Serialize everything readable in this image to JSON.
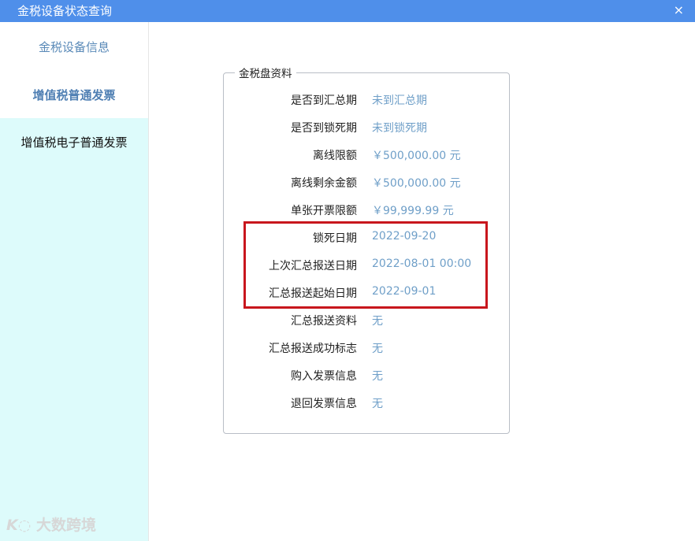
{
  "window": {
    "title": "金税设备状态查询",
    "close_label": "×"
  },
  "sidebar": {
    "items": [
      {
        "label": "金税设备信息"
      },
      {
        "label": "增值税普通发票"
      },
      {
        "label": "增值税电子普通发票"
      }
    ]
  },
  "panel": {
    "legend": "金税盘资料",
    "rows": [
      {
        "label": "是否到汇总期",
        "value": "未到汇总期"
      },
      {
        "label": "是否到锁死期",
        "value": "未到锁死期"
      },
      {
        "label": "离线限额",
        "value": "￥500,000.00 元"
      },
      {
        "label": "离线剩余金额",
        "value": "￥500,000.00 元"
      },
      {
        "label": "单张开票限额",
        "value": "￥99,999.99 元"
      },
      {
        "label": "锁死日期",
        "value": "2022-09-20"
      },
      {
        "label": "上次汇总报送日期",
        "value": "2022-08-01 00:00"
      },
      {
        "label": "汇总报送起始日期",
        "value": "2022-09-01"
      },
      {
        "label": "汇总报送资料",
        "value": "无"
      },
      {
        "label": "汇总报送成功标志",
        "value": "无"
      },
      {
        "label": "购入发票信息",
        "value": "无"
      },
      {
        "label": "退回发票信息",
        "value": "无"
      }
    ]
  },
  "watermark": {
    "text": "大数跨境"
  },
  "colors": {
    "titlebar": "#4f8fea",
    "value_text": "#6f9fc8",
    "highlight": "#c8161d",
    "sidebar_active_bg": "#ddfbfb"
  }
}
